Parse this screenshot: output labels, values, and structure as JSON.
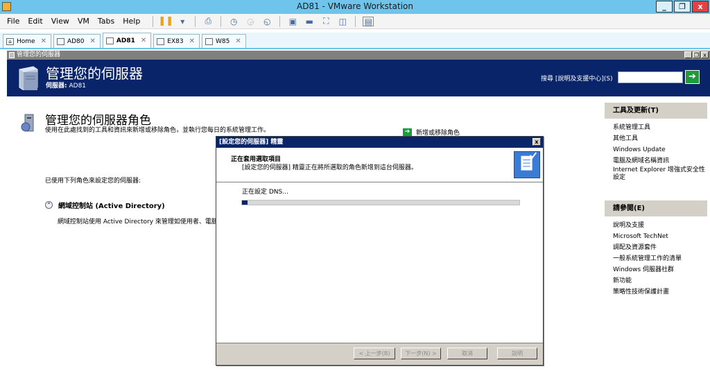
{
  "window": {
    "title": "AD81 - VMware Workstation",
    "controls": [
      "_",
      "❐",
      "x"
    ]
  },
  "menu": {
    "items": [
      "File",
      "Edit",
      "View",
      "VM",
      "Tabs",
      "Help"
    ]
  },
  "tabs": [
    {
      "label": "Home"
    },
    {
      "label": "AD80"
    },
    {
      "label": "AD81"
    },
    {
      "label": "EX83"
    },
    {
      "label": "W85"
    }
  ],
  "guest": {
    "window_title": "管理您的伺服器",
    "controls": [
      "_",
      "❐",
      "x"
    ],
    "banner": {
      "title": "管理您的伺服器",
      "server_label": "伺服器:",
      "server_name": "AD81",
      "search_label": "搜尋 [說明及支援中心](S)",
      "search_value": ""
    },
    "main": {
      "roles_title": "管理您的伺服器角色",
      "roles_desc": "使用在此處找到的工具和資訊來新增或移除角色，並執行您每日的系統管理工作。",
      "add_role": "新增或移除角色",
      "configured_text": "已使用下列角色來設定您的伺服器:",
      "ad_title": "網域控制站 (Active Directory)",
      "ad_desc": "網域控制站使用 Active Directory 來管理如使用者、電腦"
    },
    "tools": {
      "title": "工具及更新(T)",
      "links": [
        "系統管理工具",
        "其他工具",
        "Windows Update",
        "電腦及網域名稱資訊",
        "Internet Explorer 增強式安全性設定"
      ]
    },
    "see_also": {
      "title": "請參閱(E)",
      "links": [
        "說明及支援",
        "Microsoft TechNet",
        "調配及資源套件",
        "一般系統管理工作的清單",
        "Windows 伺服器社群",
        "新功能",
        "策略性技術保護計畫"
      ]
    }
  },
  "wizard": {
    "title": "[設定您的伺服器] 精靈",
    "close": "x",
    "header_title": "正在套用選取項目",
    "header_desc": "[設定您的伺服器] 精靈正在將所選取的角色新增到這台伺服器。",
    "status": "正在設定 DNS...",
    "progress": 0.02,
    "buttons": {
      "back": "< 上一步(B)",
      "next": "下一步(N) >",
      "cancel": "取消",
      "help": "說明"
    }
  }
}
